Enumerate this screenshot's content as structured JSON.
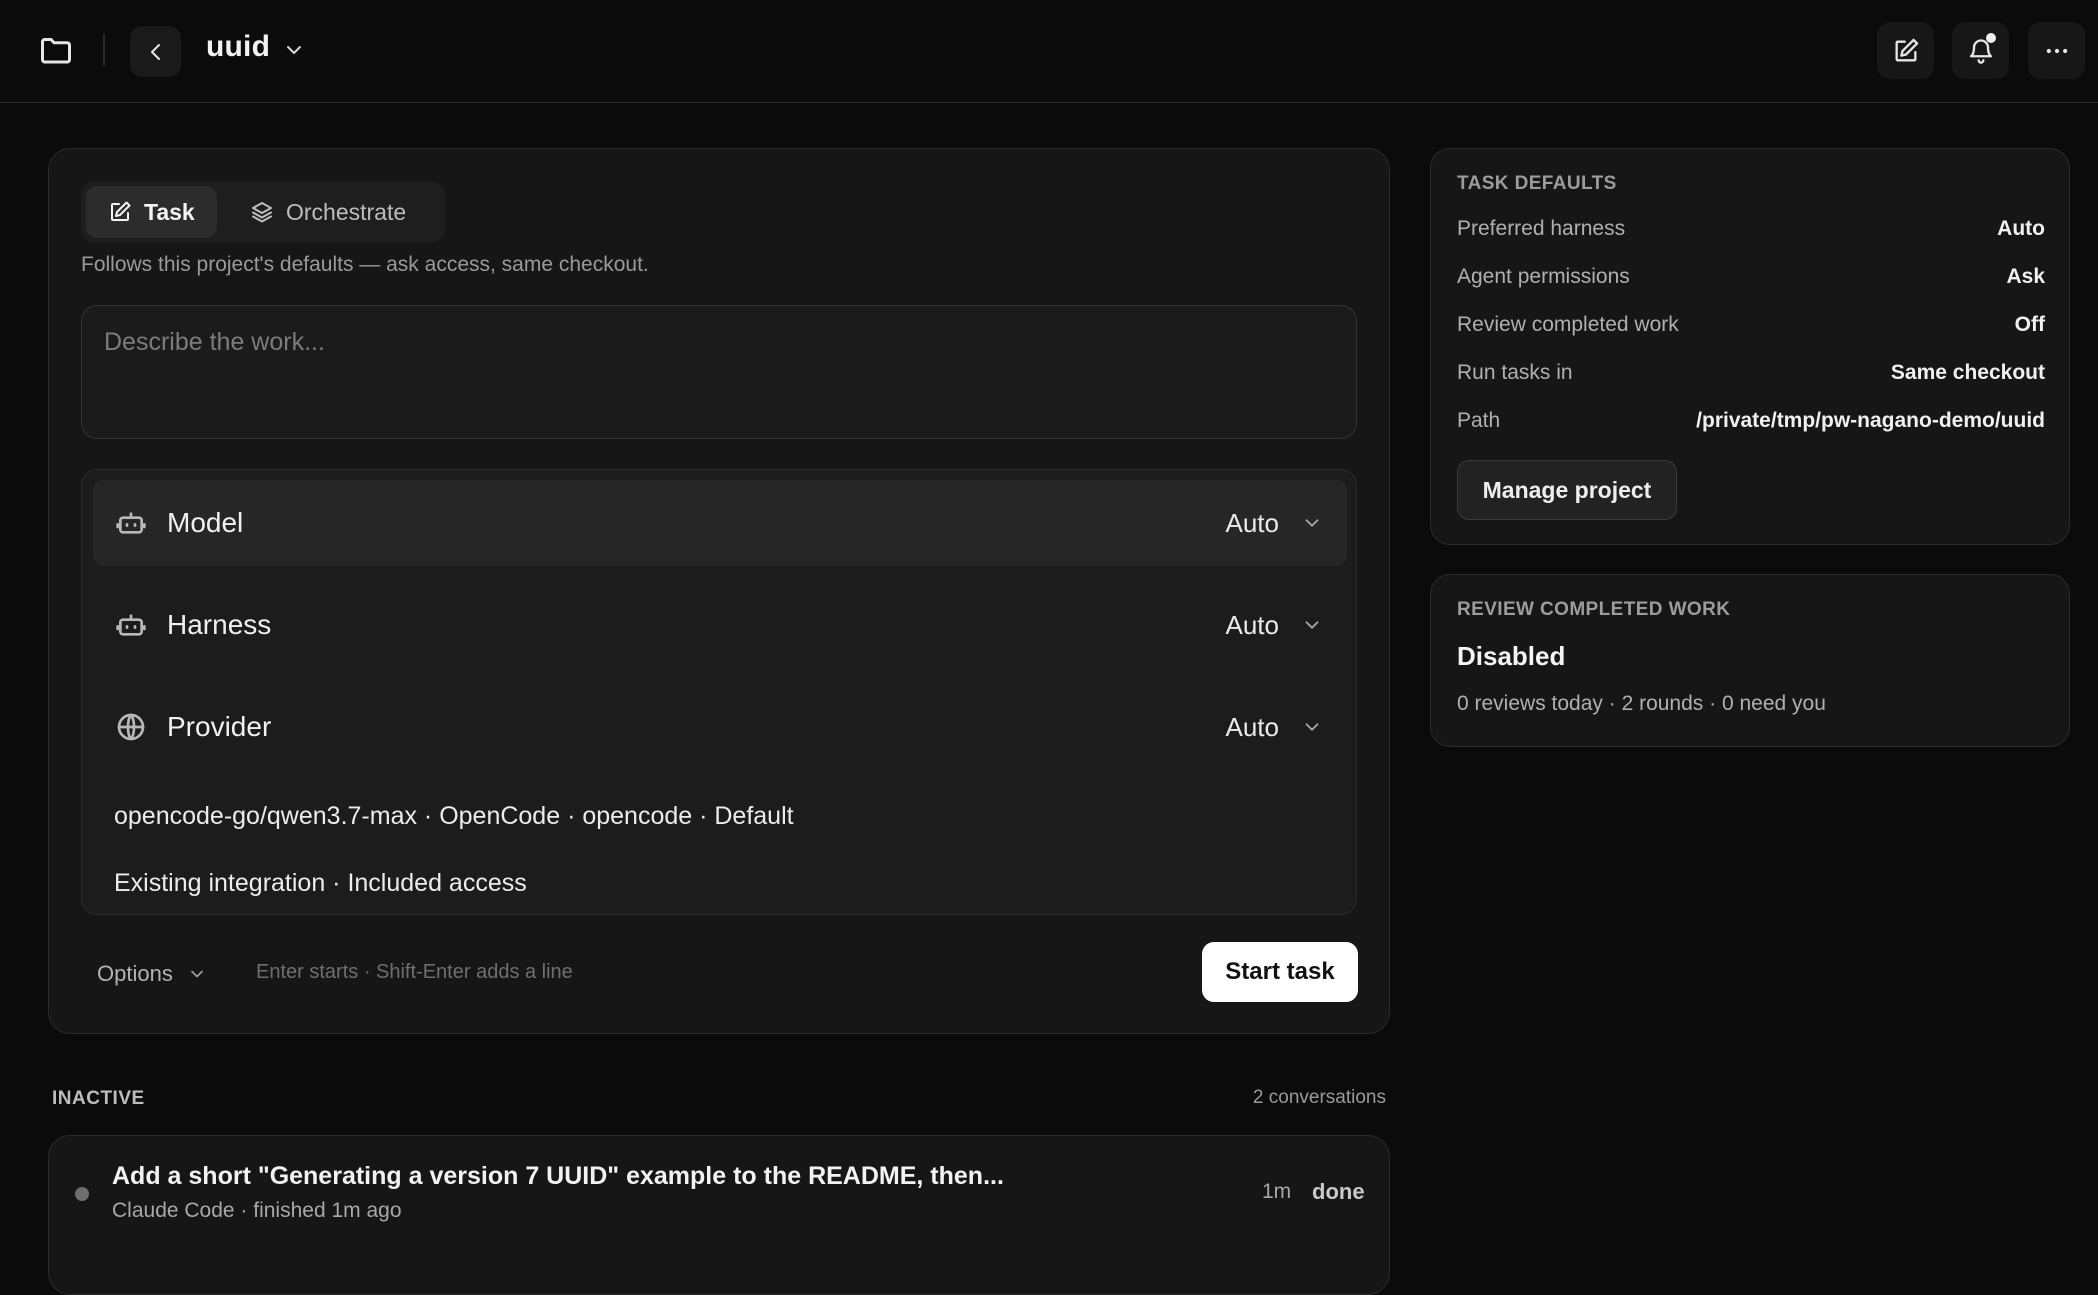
{
  "header": {
    "project_title": "uuid"
  },
  "composer": {
    "tabs": [
      {
        "label": "Task",
        "active": true,
        "icon": "edit-icon"
      },
      {
        "label": "Orchestrate",
        "active": false,
        "icon": "layers-icon"
      }
    ],
    "hint": "Follows this project's defaults — ask access, same checkout.",
    "prompt_placeholder": "Describe the work...",
    "prompt_value": "",
    "config": {
      "model": {
        "label": "Model",
        "value": "Auto",
        "icon": "bot-icon"
      },
      "harness": {
        "label": "Harness",
        "value": "Auto",
        "icon": "bot-icon"
      },
      "provider": {
        "label": "Provider",
        "value": "Auto",
        "icon": "globe-icon"
      },
      "model_detail": "opencode-go/qwen3.7-max · OpenCode · opencode · Default",
      "access_detail": "Existing integration · Included access"
    },
    "options_label": "Options",
    "keyboard_hint": "Enter starts · Shift-Enter adds a line",
    "start_label": "Start task"
  },
  "inactive": {
    "heading": "INACTIVE",
    "count": "2 conversations",
    "conversations": [
      {
        "title": "Add a short \"Generating a version 7 UUID\" example to the README, then...",
        "subtitle": "Claude Code · finished 1m ago",
        "age": "1m",
        "status": "done"
      }
    ]
  },
  "task_defaults": {
    "heading": "TASK DEFAULTS",
    "rows": [
      {
        "key": "Preferred harness",
        "value": "Auto"
      },
      {
        "key": "Agent permissions",
        "value": "Ask"
      },
      {
        "key": "Review completed work",
        "value": "Off"
      },
      {
        "key": "Run tasks in",
        "value": "Same checkout"
      },
      {
        "key": "Path",
        "value": "/private/tmp/pw-nagano-demo/uuid"
      }
    ],
    "manage_label": "Manage project"
  },
  "review": {
    "heading": "REVIEW COMPLETED WORK",
    "state": "Disabled",
    "stats": "0 reviews today · 2 rounds · 0 need you"
  },
  "colors": {
    "background": "#0b0b0b",
    "card": "#161616",
    "accent_button": "#ffffff"
  }
}
